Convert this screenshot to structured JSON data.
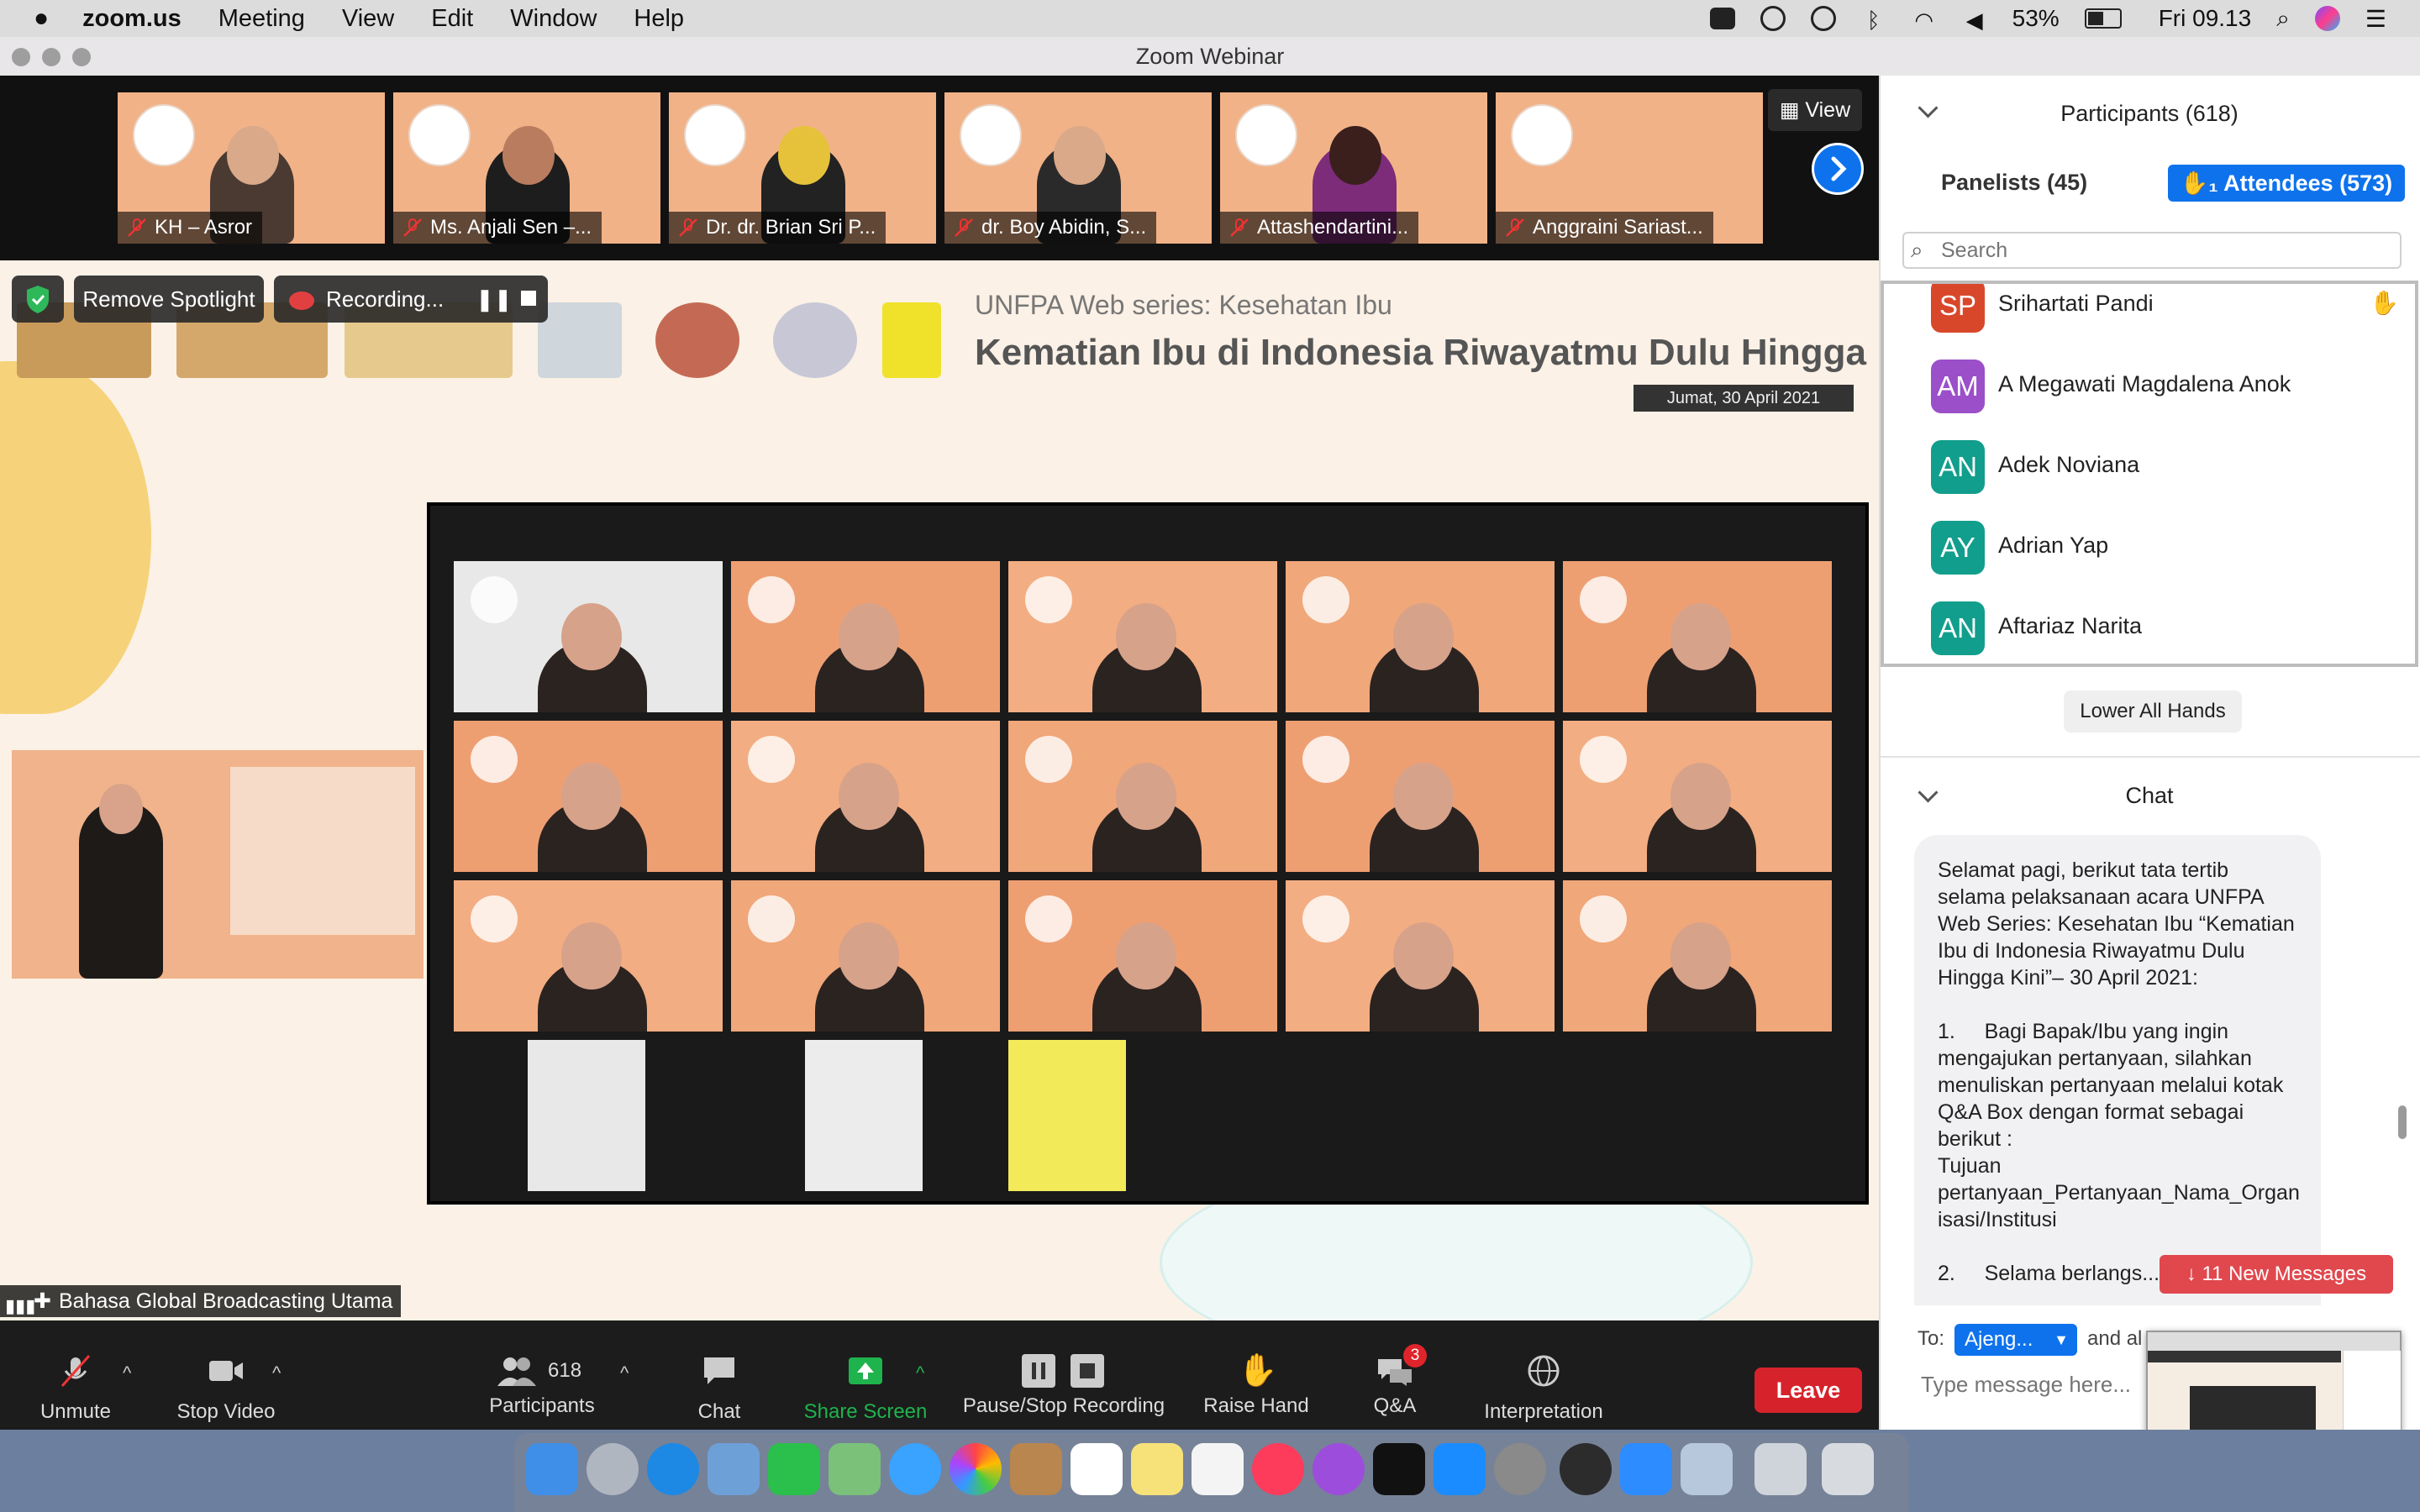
{
  "menubar": {
    "app": "zoom.us",
    "items": [
      "Meeting",
      "View",
      "Edit",
      "Window",
      "Help"
    ],
    "battery": "53%",
    "clock": "Fri 09.13"
  },
  "window": {
    "title": "Zoom Webinar"
  },
  "thumbnails": [
    {
      "name": "KH – Asror"
    },
    {
      "name": "Ms. Anjali Sen –..."
    },
    {
      "name": "Dr. dr. Brian Sri P..."
    },
    {
      "name": "dr. Boy Abidin, S..."
    },
    {
      "name": "Attashendartini..."
    },
    {
      "name": "Anggraini Sariast..."
    }
  ],
  "view_button": "View",
  "spotlight": {
    "remove_label": "Remove Spotlight",
    "recording_label": "Recording..."
  },
  "slide": {
    "series": "UNFPA Web series: Kesehatan Ibu",
    "headline": "Kematian Ibu di Indonesia Riwayatmu Dulu Hingga Kini",
    "date": "Jumat, 30 April 2021"
  },
  "speaker_label": "Bahasa Global Broadcasting Utama",
  "toolbar": {
    "unmute": "Unmute",
    "stop_video": "Stop Video",
    "participants": "Participants",
    "participants_count": "618",
    "chat": "Chat",
    "share_screen": "Share Screen",
    "pause_stop": "Pause/Stop Recording",
    "raise_hand": "Raise Hand",
    "qa": "Q&A",
    "qa_badge": "3",
    "interpretation": "Interpretation",
    "leave": "Leave"
  },
  "panel": {
    "participants_title": "Participants (618)",
    "panelists_tab": "Panelists (45)",
    "attendees_tab": "Attendees (573)",
    "search_placeholder": "Search",
    "participants": [
      {
        "initials": "SP",
        "name": "Srihartati Pandi",
        "color": "#d9472b",
        "hand": "✋"
      },
      {
        "initials": "AM",
        "name": "A Megawati Magdalena Anok",
        "color": "#9b4fc9",
        "hand": ""
      },
      {
        "initials": "AN",
        "name": "Adek Noviana",
        "color": "#129e8c",
        "hand": ""
      },
      {
        "initials": "AY",
        "name": "Adrian Yap",
        "color": "#129e8c",
        "hand": ""
      },
      {
        "initials": "AN",
        "name": "Aftariaz Narita",
        "color": "#129e8c",
        "hand": ""
      }
    ],
    "lower_all_hands": "Lower All Hands",
    "chat_title": "Chat",
    "chat_message": "Selamat pagi, berikut tata tertib selama pelaksanaan acara UNFPA Web Series: Kesehatan Ibu “Kematian Ibu di Indonesia Riwayatmu Dulu Hingga Kini”– 30 April 2021:\n\n1.     Bagi Bapak/Ibu yang ingin mengajukan pertanyaan, silahkan menuliskan pertanyaan melalui kotak Q&A Box dengan format sebagai berikut :\nTujuan pertanyaan_Pertanyaan_Nama_Organisasi/Institusi\n\n2.     Selama berlangs...",
    "new_messages": "↓ 11 New Messages",
    "to_label": "To:",
    "to_value": "Ajeng...",
    "to_suffix": "and al",
    "input_placeholder": "Type message here..."
  },
  "colors": {
    "accent": "#0e72ed",
    "leave": "#d6232b",
    "share": "#1fb34d",
    "tile": "#f0a77a"
  }
}
